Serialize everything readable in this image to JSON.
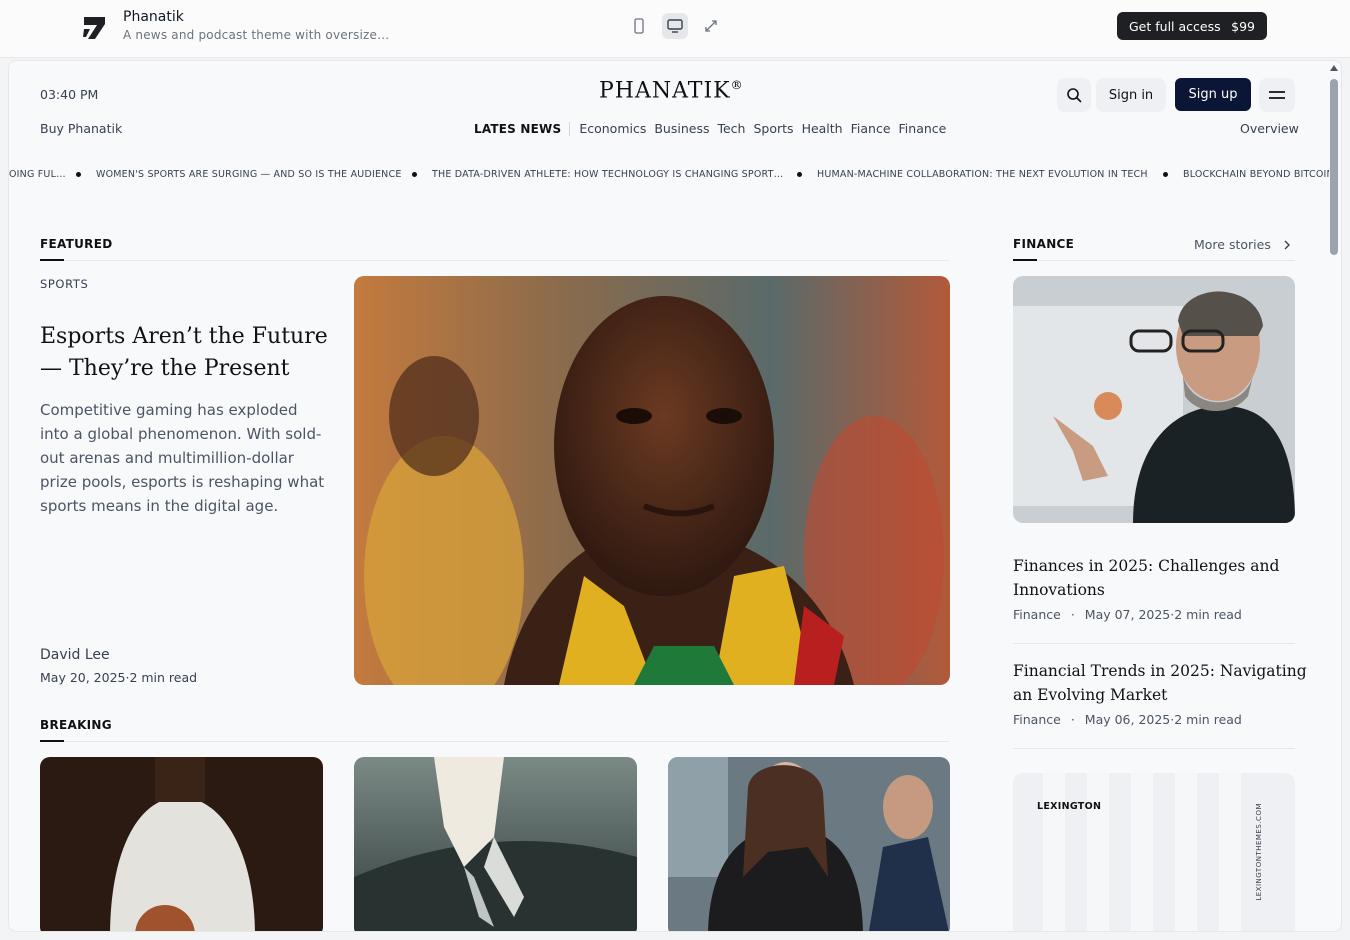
{
  "preview_bar": {
    "brand_name": "Phanatik",
    "brand_desc": "A news and podcast theme with oversize…",
    "devices": [
      "mobile-icon",
      "desktop-icon",
      "expand-icon"
    ],
    "buy_label": "Get full access",
    "buy_price": "$99"
  },
  "site": {
    "time": "03:40 PM",
    "logo": "PHANATIK",
    "logo_mark": "®",
    "signin": "Sign in",
    "signup": "Sign up",
    "buy_link": "Buy Phanatik",
    "overview": "Overview"
  },
  "nav": {
    "latest": "LATES NEWS",
    "items": [
      "Economics",
      "Business",
      "Tech",
      "Sports",
      "Health",
      "Fiance",
      "Finance"
    ]
  },
  "ticker": [
    "OING FUL…",
    "WOMEN'S SPORTS ARE SURGING — AND SO IS THE AUDIENCE",
    "THE DATA-DRIVEN ATHLETE: HOW TECHNOLOGY IS CHANGING SPORT…",
    "HUMAN-MACHINE COLLABORATION: THE NEXT EVOLUTION IN TECH",
    "BLOCKCHAIN BEYOND BITCOIN"
  ],
  "featured": {
    "section": "FEATURED",
    "category": "SPORTS",
    "title": "Esports Aren’t the Future — They’re the Present",
    "dek": "Competitive gaming has exploded into a global phenomenon. With sold-out arenas and multimillion-dollar prize pools, esports is reshaping what sports means in the digital age.",
    "author": "David Lee",
    "meta": "May 20, 2025·2 min read"
  },
  "breaking": {
    "section": "BREAKING"
  },
  "finance": {
    "section": "FINANCE",
    "more": "More stories",
    "stories": [
      {
        "title": "Finances in 2025: Challenges and Innovations",
        "category": "Finance",
        "meta": "May 07, 2025·2 min read"
      },
      {
        "title": "Financial Trends in 2025: Navigating an Evolving Market",
        "category": "Finance",
        "meta": "May 06, 2025·2 min read"
      }
    ]
  },
  "ad": {
    "brand": "LEXINGTON",
    "url": "LEXINGTONTHEMES.COM"
  }
}
